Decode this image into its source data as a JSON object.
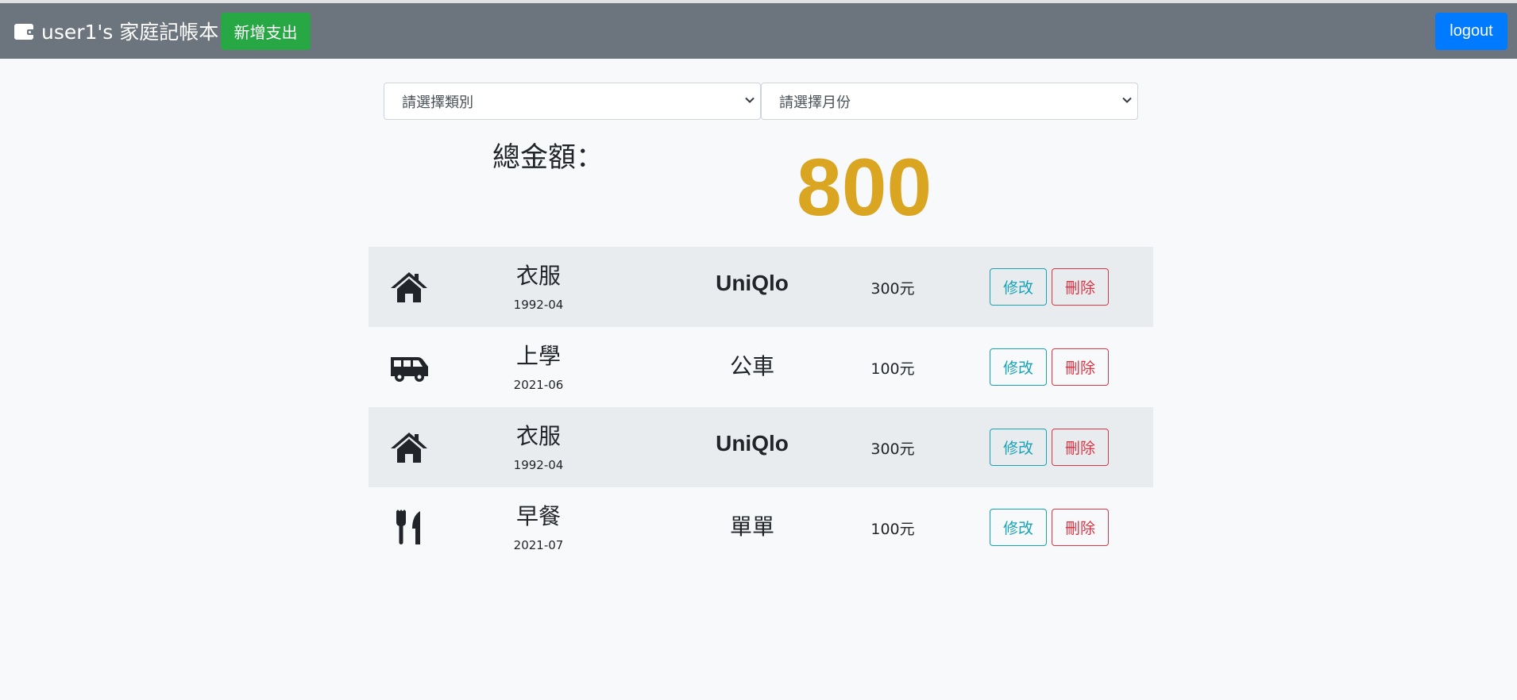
{
  "header": {
    "title": "user1's 家庭記帳本",
    "add_button": "新增支出",
    "logout_button": "logout",
    "brand_icon": "wallet-icon"
  },
  "filters": {
    "category_placeholder": "請選擇類別",
    "month_placeholder": "請選擇月份"
  },
  "summary": {
    "label": "總金額：",
    "value": "800",
    "value_color": "#daa520"
  },
  "records": [
    {
      "icon": "home-icon",
      "category": "衣服",
      "date": "1992-04",
      "name": "UniQlo",
      "amount": "300元",
      "edit_label": "修改",
      "delete_label": "刪除"
    },
    {
      "icon": "shuttle-van-icon",
      "category": "上學",
      "date": "2021-06",
      "name": "公車",
      "amount": "100元",
      "edit_label": "修改",
      "delete_label": "刪除"
    },
    {
      "icon": "home-icon",
      "category": "衣服",
      "date": "1992-04",
      "name": "UniQlo",
      "amount": "300元",
      "edit_label": "修改",
      "delete_label": "刪除"
    },
    {
      "icon": "utensils-icon",
      "category": "早餐",
      "date": "2021-07",
      "name": "單單",
      "amount": "100元",
      "edit_label": "修改",
      "delete_label": "刪除"
    }
  ],
  "colors": {
    "navbar": "#6c757d",
    "add_button": "#28a745",
    "logout_button": "#007bff",
    "edit_outline": "#17a2b8",
    "delete_outline": "#dc3545"
  }
}
